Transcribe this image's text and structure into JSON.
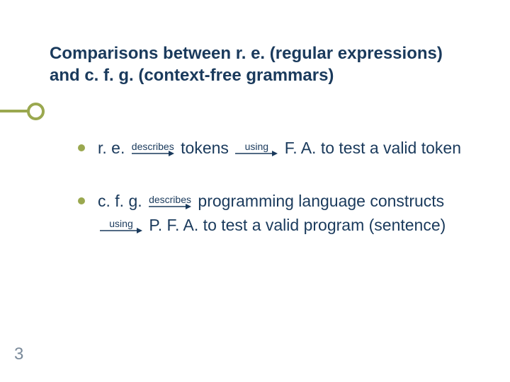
{
  "slide": {
    "title": "Comparisons between r. e. (regular expressions) and c. f. g. (context-free grammars)",
    "page_number": "3",
    "bullets": [
      {
        "pre1": "r. e.",
        "arrow1_label": "describes",
        "mid1": "tokens",
        "arrow2_label": "using",
        "post": "F. A. to test a valid token"
      },
      {
        "pre1": "c. f. g.",
        "arrow1_label": "describes",
        "mid1": "programming language constructs",
        "arrow2_label": "using",
        "post": "P. F. A. to test a valid program (sentence)"
      }
    ]
  }
}
